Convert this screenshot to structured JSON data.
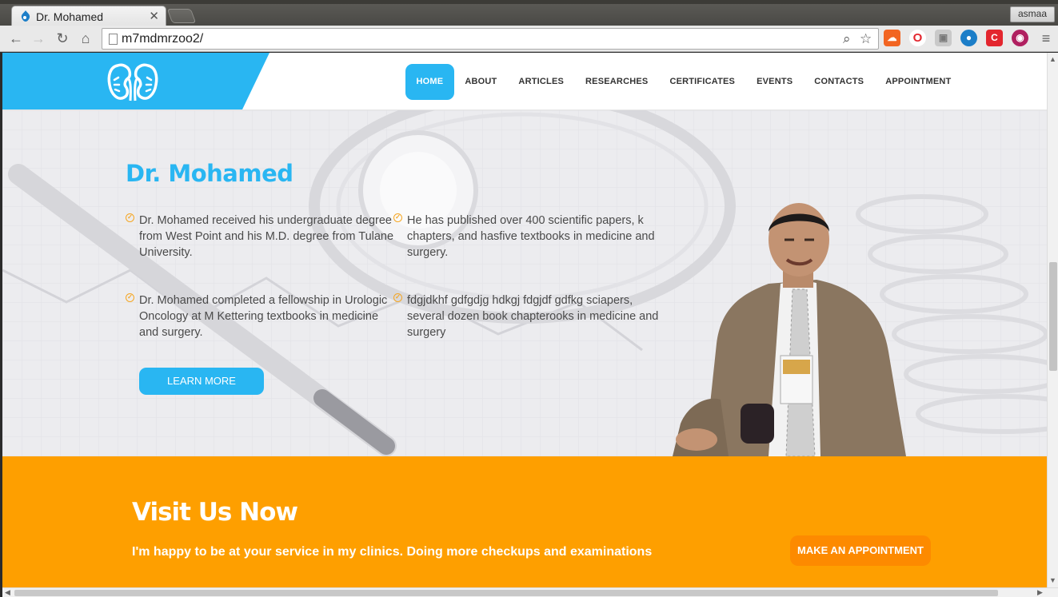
{
  "browser": {
    "tab_title": "Dr. Mohamed",
    "tab_close": "✕",
    "user_name": "asmaa",
    "url": "m7mdmrzoo2/",
    "extensions": [
      "soundcloud-icon",
      "opera-icon",
      "cube-icon",
      "drupal-icon",
      "shield-icon",
      "camera-icon"
    ]
  },
  "site": {
    "colors": {
      "primary": "#29b6f2",
      "accent": "#fe9f00",
      "button_dark": "#fd8a00"
    },
    "nav": {
      "items": [
        {
          "label": "HOME",
          "active": true
        },
        {
          "label": "ABOUT"
        },
        {
          "label": "ARTICLES"
        },
        {
          "label": "RESEARCHES"
        },
        {
          "label": "CERTIFICATES"
        },
        {
          "label": "EVENTS"
        },
        {
          "label": "CONTACTS"
        },
        {
          "label": "APPOINTMENT"
        }
      ]
    },
    "hero": {
      "title": "Dr. Mohamed",
      "bullets": [
        "Dr. Mohamed received his undergraduate degree from West Point and his M.D. degree from Tulane University.",
        "He has published over 400 scientific papers, k chapters, and hasfive textbooks in medicine and surgery.",
        "Dr. Mohamed completed a fellowship in Urologic Oncology at M Kettering textbooks in medicine and surgery.",
        "fdgjdkhf gdfgdjg hdkgj fdgjdf gdfkg sciapers, several dozen book chapterooks in medicine and surgery"
      ],
      "learn_more": "LEARN MORE"
    },
    "cta": {
      "title": "Visit Us Now",
      "text": "I'm happy to be at your service in my clinics. Doing more checkups and examinations",
      "button": "MAKE AN APPOINTMENT"
    }
  }
}
